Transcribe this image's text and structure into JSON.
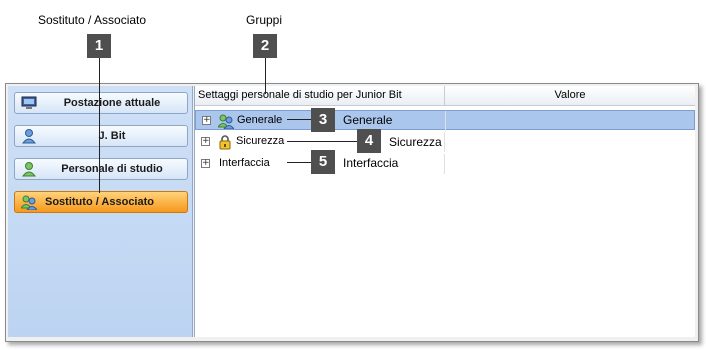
{
  "callouts": {
    "sostituto_title": "Sostituto / Associato",
    "gruppi_title": "Gruppi",
    "badges": [
      "1",
      "2",
      "3",
      "4",
      "5"
    ]
  },
  "sidebar": {
    "items": [
      {
        "label": "Postazione attuale",
        "icon": "computer-icon",
        "active": false
      },
      {
        "label": "J. Bit",
        "icon": "user-icon",
        "active": false
      },
      {
        "label": "Personale di studio",
        "icon": "staff-icon",
        "active": false
      },
      {
        "label": "Sostituto / Associato",
        "icon": "associate-users-icon",
        "active": true
      }
    ]
  },
  "grid": {
    "header_settings": "Settaggi personale di studio per Junior Bit",
    "header_value": "Valore",
    "rows": [
      {
        "label": "Generale",
        "icon": "users-icon",
        "selected": true,
        "annotation": "Generale"
      },
      {
        "label": "Sicurezza",
        "icon": "lock-icon",
        "selected": false,
        "annotation": "Sicurezza"
      },
      {
        "label": "Interfaccia",
        "icon": "",
        "selected": false,
        "annotation": "Interfaccia"
      }
    ]
  },
  "colors": {
    "sidebar_bg": "#c5d9f3",
    "active_button": "#f7981d",
    "selected_row": "#abc6ec",
    "badge_bg": "#4f4f4f"
  }
}
